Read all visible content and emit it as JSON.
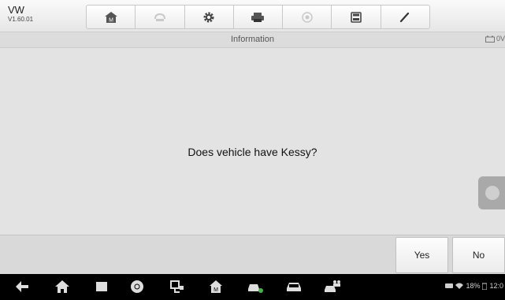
{
  "header": {
    "make": "VW",
    "version": "V1.60.01",
    "tools": [
      {
        "icon": "home-icon"
      },
      {
        "icon": "vehicle-swap-icon"
      },
      {
        "icon": "gear-icon"
      },
      {
        "icon": "print-icon"
      },
      {
        "icon": "help-icon"
      },
      {
        "icon": "save-icon"
      },
      {
        "icon": "pen-icon"
      }
    ]
  },
  "titlebar": {
    "title": "Information",
    "battery_text": "0V"
  },
  "main": {
    "question": "Does vehicle have Kessy?"
  },
  "actions": {
    "yes_label": "Yes",
    "no_label": "No"
  },
  "status": {
    "battery_percent": "18%",
    "time": "12:0"
  },
  "nav": {
    "icons": [
      "back-icon",
      "home-icon",
      "recent-apps-icon",
      "chrome-icon",
      "vci-connection-icon",
      "autel-home-icon",
      "car-service-icon",
      "car-icon",
      "car-people-icon"
    ]
  },
  "colors": {
    "background": "#e3e3e3",
    "navbar": "#000000",
    "side_handle": "#a9a9a9"
  }
}
